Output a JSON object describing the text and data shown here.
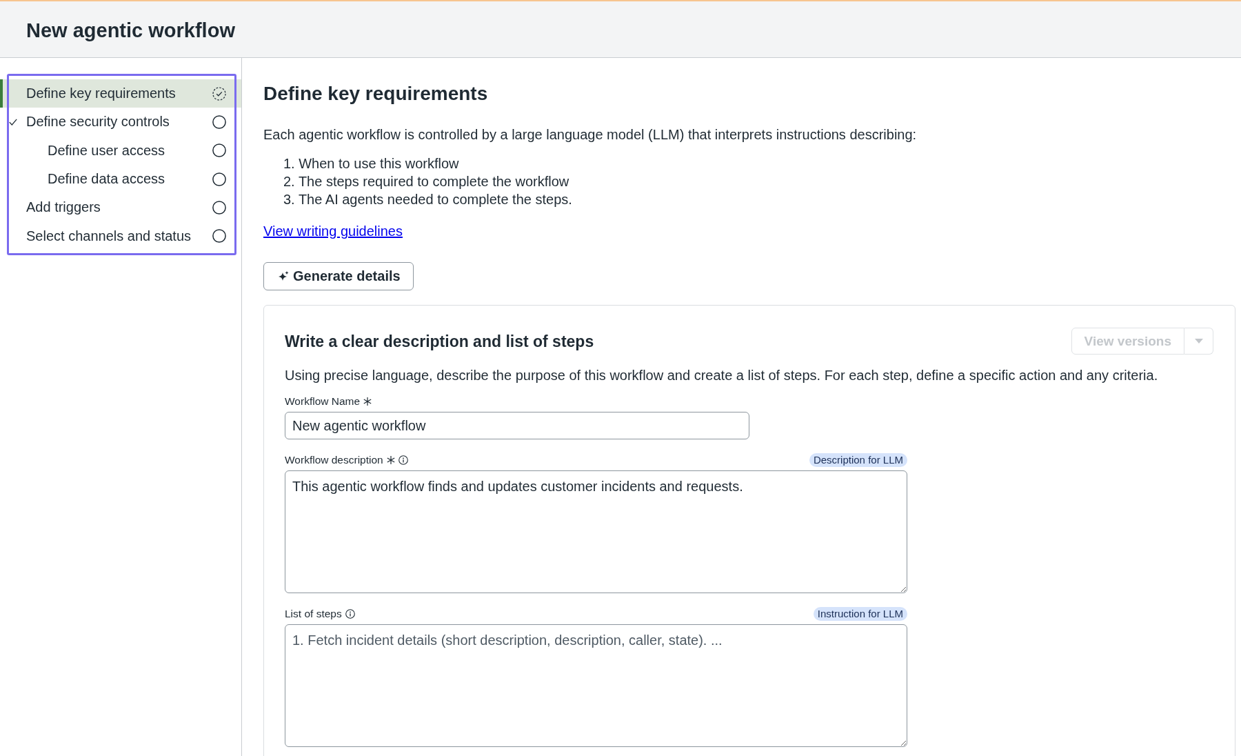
{
  "header": {
    "title": "New agentic workflow"
  },
  "sidebar": {
    "items": [
      {
        "label": "Define key requirements",
        "selected": true,
        "checked": false,
        "in_progress": true
      },
      {
        "label": "Define security controls",
        "selected": false,
        "checked": true,
        "in_progress": false,
        "children": [
          {
            "label": "Define user access",
            "selected": false,
            "checked": false,
            "in_progress": false
          },
          {
            "label": "Define data access",
            "selected": false,
            "checked": false,
            "in_progress": false
          }
        ]
      },
      {
        "label": "Add triggers",
        "selected": false,
        "checked": false,
        "in_progress": false
      },
      {
        "label": "Select channels and status",
        "selected": false,
        "checked": false,
        "in_progress": false
      }
    ]
  },
  "main": {
    "heading": "Define key requirements",
    "intro": "Each agentic workflow is controlled by a large language model (LLM) that interprets instructions describing:",
    "steps": [
      "1. When to use this workflow",
      "2. The steps required to complete the workflow",
      "3. The AI agents needed to complete the steps."
    ],
    "link": "View writing guidelines",
    "generate_button": "Generate details",
    "card": {
      "title": "Write a clear description and list of steps",
      "versions_button": {
        "label": "View versions",
        "disabled": true
      },
      "description": "Using precise language, describe the purpose of this workflow and create a list of steps. For each step, define a specific action and any criteria.",
      "fields": [
        {
          "kind": "input",
          "label": "Workflow Name",
          "required": true,
          "info": false,
          "value": "New agentic workflow"
        },
        {
          "kind": "textarea",
          "label": "Workflow description",
          "required": true,
          "info": true,
          "badge": "Description for LLM",
          "value": "This agentic workflow finds and updates customer incidents and requests."
        },
        {
          "kind": "textarea",
          "label": "List of steps",
          "required": false,
          "info": true,
          "badge": "Instruction for LLM",
          "placeholder": "1. Fetch incident details (short description, description, caller, state). ..."
        }
      ]
    }
  }
}
